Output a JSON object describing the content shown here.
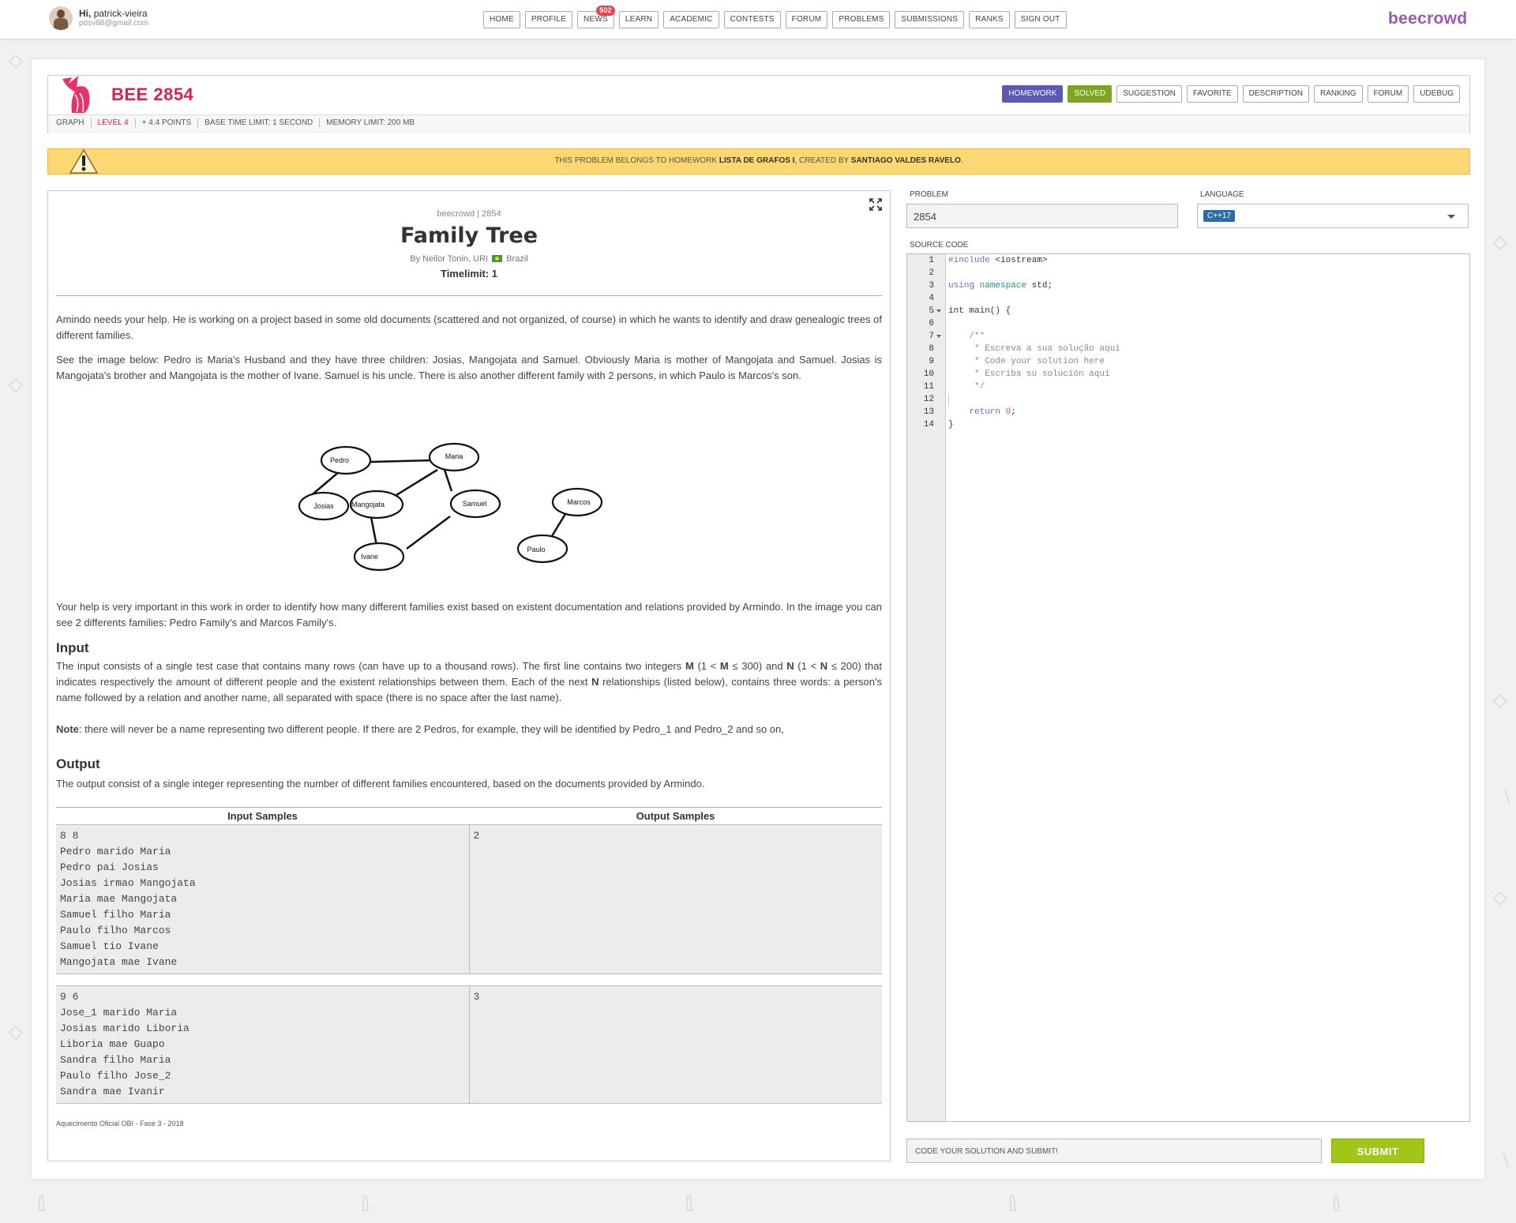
{
  "topnav": {
    "greeting": "Hi,",
    "username": "patrick-vieira",
    "email": "pdsv88@gmail.com",
    "menu": [
      "HOME",
      "PROFILE",
      "NEWS",
      "LEARN",
      "ACADEMIC",
      "CONTESTS",
      "FORUM",
      "PROBLEMS",
      "SUBMISSIONS",
      "RANKS",
      "SIGN OUT"
    ],
    "news_badge": "502",
    "logo": "beecrowd"
  },
  "problem_header": {
    "code": "BEE 2854",
    "info": [
      "GRAPH",
      "LEVEL 4",
      "+ 4.4 POINTS",
      "BASE TIME LIMIT: 1 SECOND",
      "MEMORY LIMIT: 200 MB"
    ],
    "buttons": [
      "HOMEWORK",
      "SOLVED",
      "SUGGESTION",
      "FAVORITE",
      "DESCRIPTION",
      "RANKING",
      "FORUM",
      "UDEBUG"
    ]
  },
  "notice": {
    "prefix": "This problem belongs to homework ",
    "homework": "LISTA DE GRAFOS I",
    "middle": ", created by ",
    "creator": "SANTIAGO VALDES RAVELO",
    "suffix": "."
  },
  "problem": {
    "source": "beecrowd | 2854",
    "title": "Family Tree",
    "author_prefix": "By Neilor Tonin, URI",
    "author_country": "Brazil",
    "timelimit": "Timelimit: 1",
    "p1": "Amindo needs your help. He is working on a project based in some old documents (scattered and not organized, of course) in which he wants to identify and draw genealogic trees of different families.",
    "p2": "See the image below: Pedro is Maria's Husband and they have three children: Josias, Mangojata and Samuel. Obviously Maria is mother of Mangojata and Samuel. Josias is Mangojata's brother and Mangojata is the mother of Ivane. Samuel is his uncle. There is also another different family with 2 persons, in which Paulo is Marcos's son.",
    "graph_nodes": [
      "Pedro",
      "Maria",
      "Josias",
      "Mangojata",
      "Samuel",
      "Ivane",
      "Marcos",
      "Paulo"
    ],
    "p3": "Your help is very important in this work in order to identify how many different families exist based on existent documentation and relations provided by Armindo. In the image you can see 2 differents families: Pedro Family's and Marcos Family's.",
    "input_title": "Input",
    "input_a": "The input consists of a single test case that contains many rows (can have up to a thousand rows). The first line contains two integers ",
    "input_M": "M",
    "input_b": " (1 < ",
    "input_M2": "M",
    "input_c": " ≤ 300) and ",
    "input_N": "N",
    "input_d": " (1 < ",
    "input_N2": "N",
    "input_e": " ≤ 200) that indicates respectively the amount of different people and the existent relationships between them. Each of the next ",
    "input_N3": "N",
    "input_f": " relationships (listed below), contains three words: a person's name followed by a relation and another name, all separated with space (there is no space after the last name).",
    "note_label": "Note",
    "note_text": ": there will never be a name representing two different people. If there are 2 Pedros, for example, they will be identified by Pedro_1 and Pedro_2 and so on,",
    "output_title": "Output",
    "output_text": "The output consist of a single integer representing the number of different families encountered, based on the documents provided by Armindo.",
    "input_samples_header": "Input Samples",
    "output_samples_header": "Output Samples",
    "sample1_in": "8 8\nPedro marido Maria\nPedro pai Josias\nJosias irmao Mangojata\nMaria mae Mangojata\nSamuel filho Maria\nPaulo filho Marcos\nSamuel tio Ivane\nMangojata mae Ivane",
    "sample1_out": "2",
    "sample2_in": "9 6\nJose_1 marido Maria\nJosias marido Liboria\nLiboria mae Guapo\nSandra filho Maria\nPaulo filho Jose_2\nSandra mae Ivanir",
    "sample2_out": "3",
    "footer": "Aquecimento Oficial OBI - Fase 3 - 2018"
  },
  "editor": {
    "problem_label": "PROBLEM",
    "problem_value": "2854",
    "language_label": "LANGUAGE",
    "language_value": "C++17",
    "source_label": "SOURCE CODE",
    "line_numbers": [
      "1",
      "2",
      "3",
      "4",
      "5",
      "6",
      "7",
      "8",
      "9",
      "10",
      "11",
      "12",
      "13",
      "14"
    ],
    "submit_message": "CODE YOUR SOLUTION AND SUBMIT!",
    "submit_label": "SUBMIT"
  },
  "colors": {
    "brand": "#9b59b6",
    "problem_code": "#d9234f",
    "homework_btn": "#5a59b5",
    "solved_btn": "#7ea71f",
    "submit_btn": "#a2c617",
    "notice_bg": "#fbd874"
  }
}
